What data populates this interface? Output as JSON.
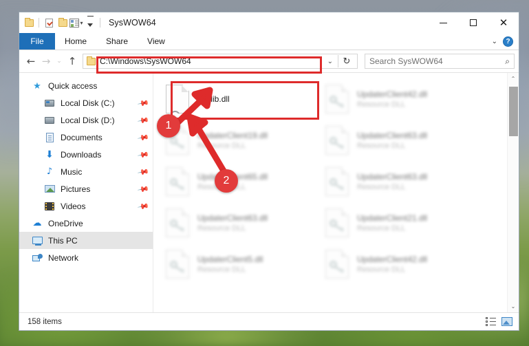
{
  "window": {
    "title": "SysWOW64",
    "quick_access_icons": [
      "folder-icon",
      "properties-icon",
      "new-folder-icon",
      "customize-view-icon",
      "customize-quick-access-icon"
    ],
    "controls": {
      "minimize": "minimize-button",
      "maximize": "maximize-button",
      "close": "close-button"
    }
  },
  "ribbon": {
    "tabs": [
      {
        "label": "File",
        "active": true
      },
      {
        "label": "Home",
        "active": false
      },
      {
        "label": "Share",
        "active": false
      },
      {
        "label": "View",
        "active": false
      }
    ],
    "collapse_icon": "chevron-down-icon",
    "help_icon": "help-icon",
    "help_label": "?"
  },
  "address_bar": {
    "back_icon": "back-arrow-icon",
    "forward_icon": "forward-arrow-icon",
    "recent_icon": "recent-locations-icon",
    "up_icon": "up-arrow-icon",
    "path": "C:\\Windows\\SysWOW64",
    "dropdown_icon": "chevron-down-icon",
    "refresh_icon": "refresh-icon",
    "refresh_glyph": "↻"
  },
  "search": {
    "placeholder": "Search SysWOW64",
    "icon": "search-icon",
    "glyph": "⌕"
  },
  "sidebar": {
    "items": [
      {
        "label": "Quick access",
        "icon": "star-icon",
        "indent": false,
        "pinned": false,
        "selected": false
      },
      {
        "label": "Local Disk (C:)",
        "icon": "drive-icon",
        "indent": true,
        "pinned": true,
        "selected": false
      },
      {
        "label": "Local Disk (D:)",
        "icon": "drive-icon",
        "indent": true,
        "pinned": true,
        "selected": false
      },
      {
        "label": "Documents",
        "icon": "documents-icon",
        "indent": true,
        "pinned": true,
        "selected": false
      },
      {
        "label": "Downloads",
        "icon": "downloads-icon",
        "indent": true,
        "pinned": true,
        "selected": false
      },
      {
        "label": "Music",
        "icon": "music-icon",
        "indent": true,
        "pinned": true,
        "selected": false
      },
      {
        "label": "Pictures",
        "icon": "pictures-icon",
        "indent": true,
        "pinned": true,
        "selected": false
      },
      {
        "label": "Videos",
        "icon": "videos-icon",
        "indent": true,
        "pinned": true,
        "selected": false
      },
      {
        "label": "OneDrive",
        "icon": "onedrive-icon",
        "indent": false,
        "pinned": false,
        "selected": false
      },
      {
        "label": "This PC",
        "icon": "this-pc-icon",
        "indent": false,
        "pinned": false,
        "selected": true
      },
      {
        "label": "Network",
        "icon": "network-icon",
        "indent": false,
        "pinned": false,
        "selected": false
      }
    ]
  },
  "files": [
    {
      "name": "dsplib.dll",
      "subtitle": "",
      "icon": "gears-file-icon",
      "highlighted": true,
      "blurred": false
    },
    {
      "name": "UpdaterClient42.dll",
      "subtitle": "Resource DLL",
      "icon": "key-file-icon",
      "highlighted": false,
      "blurred": true
    },
    {
      "name": "UpdaterClient19.dll",
      "subtitle": "Resource DLL",
      "icon": "key-file-icon",
      "highlighted": false,
      "blurred": true
    },
    {
      "name": "UpdaterClient63.dll",
      "subtitle": "Resource DLL",
      "icon": "key-file-icon",
      "highlighted": false,
      "blurred": true
    },
    {
      "name": "UpdaterClient65.dll",
      "subtitle": "Resource DLL",
      "icon": "key-file-icon",
      "highlighted": false,
      "blurred": true
    },
    {
      "name": "UpdaterClient63.dll",
      "subtitle": "Resource DLL",
      "icon": "key-file-icon",
      "highlighted": false,
      "blurred": true
    },
    {
      "name": "UpdaterClient63.dll",
      "subtitle": "Resource DLL",
      "icon": "key-file-icon",
      "highlighted": false,
      "blurred": true
    },
    {
      "name": "UpdaterClient21.dll",
      "subtitle": "Resource DLL",
      "icon": "key-file-icon",
      "highlighted": false,
      "blurred": true
    },
    {
      "name": "UpdaterClient5.dll",
      "subtitle": "Resource DLL",
      "icon": "key-file-icon",
      "highlighted": false,
      "blurred": true
    },
    {
      "name": "UpdaterClient42.dll",
      "subtitle": "Resource DLL",
      "icon": "key-file-icon",
      "highlighted": false,
      "blurred": true
    }
  ],
  "statusbar": {
    "item_count": "158 items",
    "details_view_icon": "details-view-icon",
    "large-icons_view_icon": "large-icons-view-icon"
  },
  "annotations": {
    "badge_1": "1",
    "badge_2": "2",
    "accent_color": "#de2b2b",
    "highlight_targets": [
      "address-bar",
      "dsplib-dll-file"
    ]
  },
  "scrollbar": {
    "up_glyph": "⌃",
    "down_glyph": "⌄"
  }
}
